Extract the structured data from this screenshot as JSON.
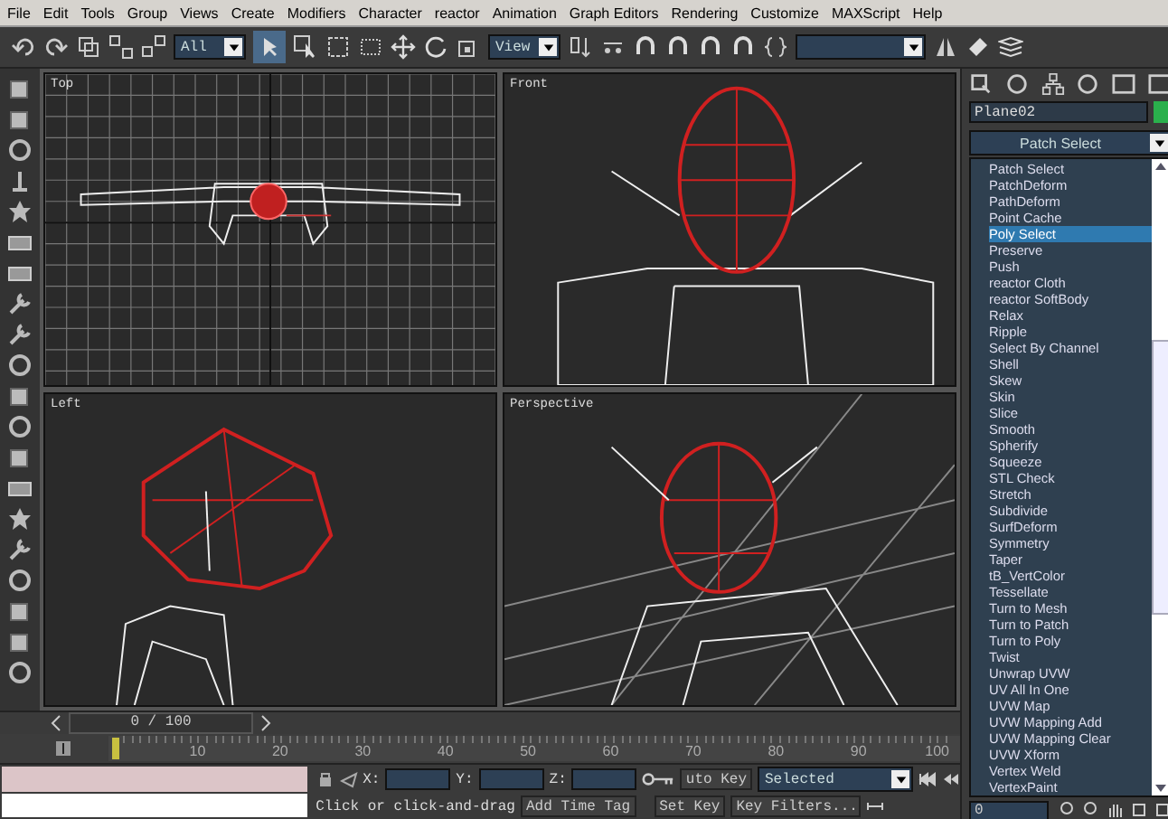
{
  "menu": [
    "File",
    "Edit",
    "Tools",
    "Group",
    "Views",
    "Create",
    "Modifiers",
    "Character",
    "reactor",
    "Animation",
    "Graph Editors",
    "Rendering",
    "Customize",
    "MAXScript",
    "Help"
  ],
  "toolbar": {
    "selection_filter": "All",
    "reference_coord": "View"
  },
  "viewports": [
    {
      "label": "Top",
      "kind": "top"
    },
    {
      "label": "Front",
      "kind": "front"
    },
    {
      "label": "Left",
      "kind": "left"
    },
    {
      "label": "Perspective",
      "kind": "perspective"
    }
  ],
  "command_panel": {
    "object_name": "Plane02",
    "modifier_dropdown": "Patch Select",
    "modifier_list": [
      {
        "label": "Patch Select",
        "selected": false
      },
      {
        "label": "PatchDeform",
        "selected": false
      },
      {
        "label": "PathDeform",
        "selected": false
      },
      {
        "label": "Point Cache",
        "selected": false
      },
      {
        "label": "Poly Select",
        "selected": true
      },
      {
        "label": "Preserve",
        "selected": false
      },
      {
        "label": "Push",
        "selected": false
      },
      {
        "label": "reactor Cloth",
        "selected": false
      },
      {
        "label": "reactor SoftBody",
        "selected": false
      },
      {
        "label": "Relax",
        "selected": false
      },
      {
        "label": "Ripple",
        "selected": false
      },
      {
        "label": "Select By Channel",
        "selected": false
      },
      {
        "label": "Shell",
        "selected": false
      },
      {
        "label": "Skew",
        "selected": false
      },
      {
        "label": "Skin",
        "selected": false
      },
      {
        "label": "Slice",
        "selected": false
      },
      {
        "label": "Smooth",
        "selected": false
      },
      {
        "label": "Spherify",
        "selected": false
      },
      {
        "label": "Squeeze",
        "selected": false
      },
      {
        "label": "STL Check",
        "selected": false
      },
      {
        "label": "Stretch",
        "selected": false
      },
      {
        "label": "Subdivide",
        "selected": false
      },
      {
        "label": "SurfDeform",
        "selected": false
      },
      {
        "label": "Symmetry",
        "selected": false
      },
      {
        "label": "Taper",
        "selected": false
      },
      {
        "label": "tB_VertColor",
        "selected": false
      },
      {
        "label": "Tessellate",
        "selected": false
      },
      {
        "label": "Turn to Mesh",
        "selected": false
      },
      {
        "label": "Turn to Patch",
        "selected": false
      },
      {
        "label": "Turn to Poly",
        "selected": false
      },
      {
        "label": "Twist",
        "selected": false
      },
      {
        "label": "Unwrap UVW",
        "selected": false
      },
      {
        "label": "UV All In One",
        "selected": false
      },
      {
        "label": "UVW Map",
        "selected": false
      },
      {
        "label": "UVW Mapping Add",
        "selected": false
      },
      {
        "label": "UVW Mapping Clear",
        "selected": false
      },
      {
        "label": "UVW Xform",
        "selected": false
      },
      {
        "label": "Vertex Weld",
        "selected": false
      },
      {
        "label": "VertexPaint",
        "selected": false
      }
    ]
  },
  "time_slider": "0 / 100",
  "trackbar_ticks": [
    "10",
    "20",
    "30",
    "40",
    "50",
    "60",
    "70",
    "80",
    "90",
    "100"
  ],
  "status": {
    "coords": [
      "X:",
      "Y:",
      "Z:"
    ],
    "auto_key": "uto Key",
    "key_mode": "Selected",
    "set_key": "Set Key",
    "key_filters": "Key Filters...",
    "current_frame": "0",
    "prompt": "Click or click-and-drag",
    "time_tag": "Add Time Tag"
  }
}
